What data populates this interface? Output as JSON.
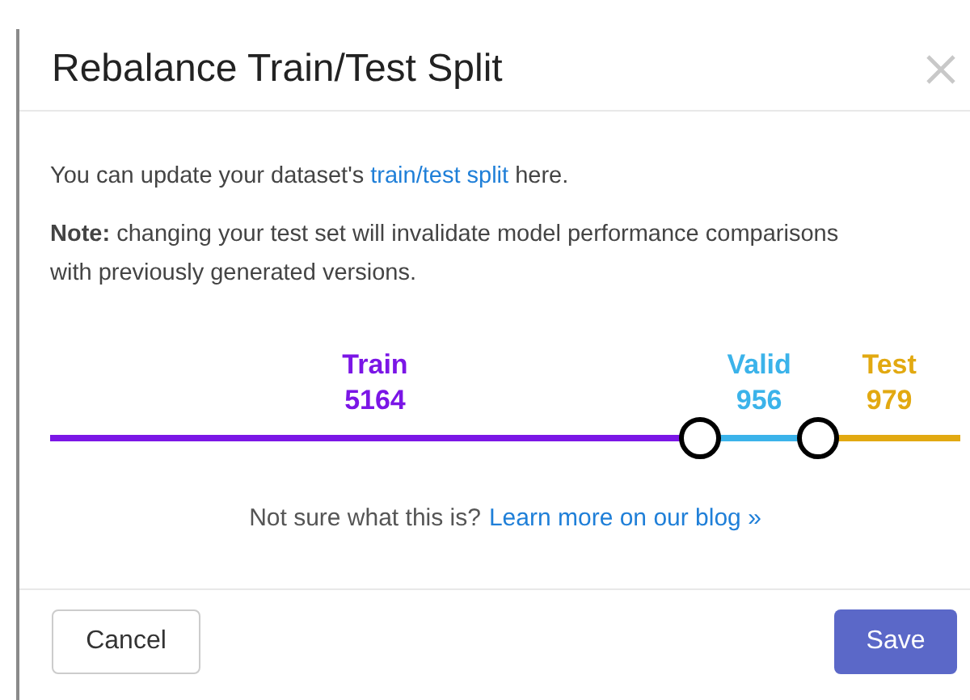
{
  "dialog": {
    "title": "Rebalance Train/Test Split",
    "intro": {
      "before": "You can update your dataset's ",
      "link": "train/test split",
      "after": " here."
    },
    "note": "**Note:** changing your test set will invalidate model performance comparisons with previously generated versions.",
    "splits": [
      {
        "label": "Train",
        "count": "5164",
        "color": "#7b16e6"
      },
      {
        "label": "Valid",
        "count": "956",
        "color": "#3bb3ea"
      },
      {
        "label": "Test",
        "count": "979",
        "color": "#e2a911"
      }
    ],
    "handles": [
      {
        "level": 0.714
      },
      {
        "level": 0.844
      }
    ],
    "help": {
      "text": "Not sure what this is?",
      "link": "Learn more on our blog »"
    },
    "buttons": {
      "cancel": "Cancel",
      "save": "Save"
    }
  }
}
